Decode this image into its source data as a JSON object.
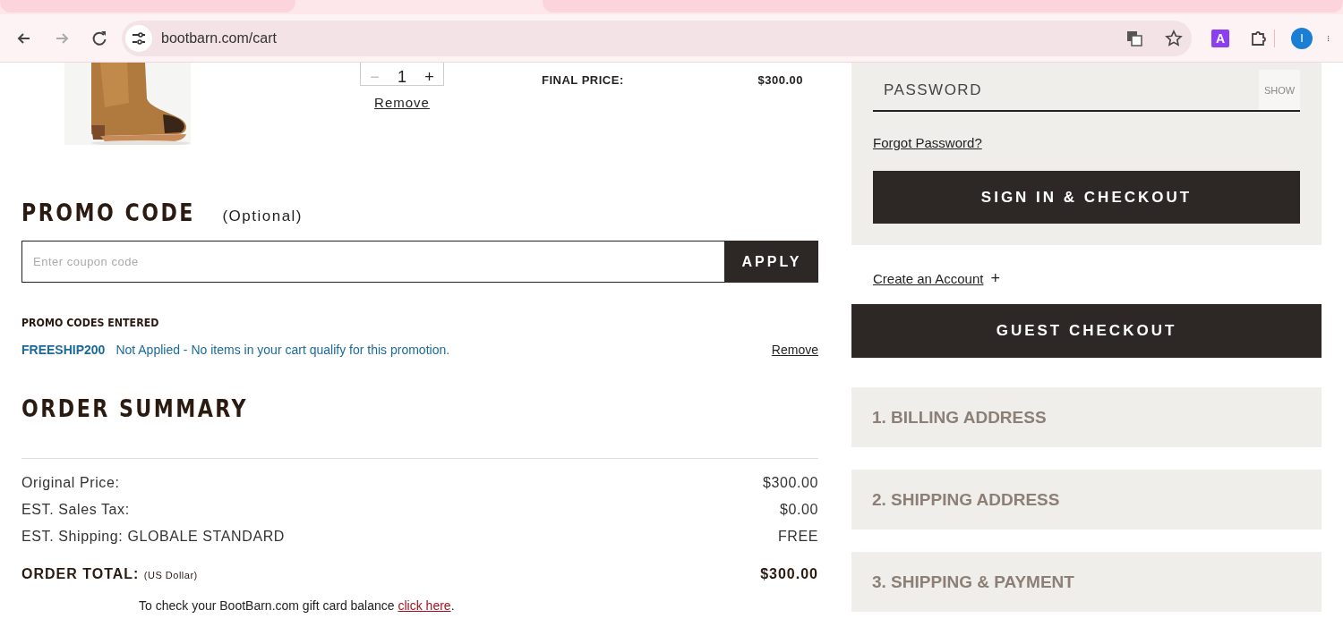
{
  "browser": {
    "url": "bootbarn.com/cart",
    "profile_initial": "I",
    "extension_letter": "A"
  },
  "cart_item": {
    "quantity": "1",
    "minus": "−",
    "plus": "+",
    "remove": "Remove",
    "final_price_label": "FINAL PRICE:",
    "final_price": "$300.00"
  },
  "promo": {
    "title": "PROMO CODE",
    "optional": "(Optional)",
    "placeholder": "Enter coupon code",
    "apply": "APPLY",
    "entered_title": "PROMO CODES ENTERED",
    "codes": [
      {
        "code": "FREESHIP200",
        "message": "Not Applied - No items in your cart qualify for this promotion.",
        "remove": "Remove"
      }
    ]
  },
  "order_summary": {
    "title": "ORDER SUMMARY",
    "rows": [
      {
        "label": "Original Price:",
        "value": "$300.00"
      },
      {
        "label": "EST. Sales Tax:",
        "value": "$0.00"
      },
      {
        "label": "EST. Shipping: GLOBALE STANDARD",
        "value": "FREE"
      }
    ],
    "total_label": "ORDER TOTAL:",
    "total_currency": "(US Dollar)",
    "total_value": "$300.00",
    "gift_text": "To check your BootBarn.com gift card balance ",
    "gift_link": "click here",
    "gift_end": "."
  },
  "sign_in": {
    "password_placeholder": "PASSWORD",
    "show": "SHOW",
    "forgot": "Forgot Password?",
    "button": "SIGN IN & CHECKOUT",
    "create_account": "Create an Account",
    "create_plus": "+",
    "guest": "GUEST CHECKOUT"
  },
  "steps": [
    "1. BILLING ADDRESS",
    "2. SHIPPING ADDRESS",
    "3. SHIPPING & PAYMENT"
  ]
}
